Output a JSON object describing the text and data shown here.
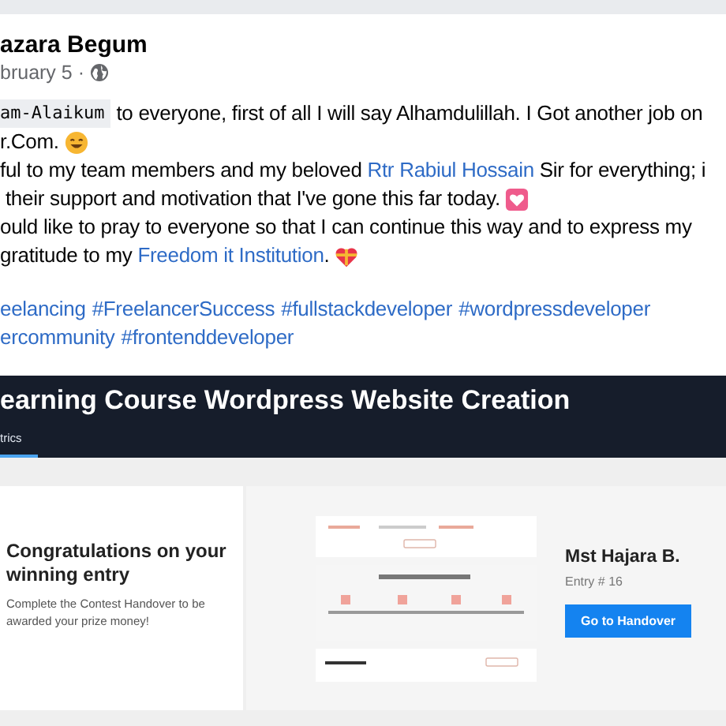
{
  "post": {
    "author": "azara Begum",
    "date": "bruary 5 ·",
    "body": [
      [
        {
          "kind": "code",
          "text": "am-Alaikum"
        },
        {
          "kind": "text",
          "text": " to everyone, first of all I will say Alhamdulillah. I Got another job on"
        }
      ],
      [
        {
          "kind": "text",
          "text": "r.Com. "
        },
        {
          "kind": "smiley"
        }
      ],
      [
        {
          "kind": "text",
          "text": "ful to my team members and my beloved "
        },
        {
          "kind": "link",
          "text": "Rtr Rabiul Hossain"
        },
        {
          "kind": "text",
          "text": " Sir for everything; i"
        }
      ],
      [
        {
          "kind": "text",
          "text": " their support and motivation that I've gone this far today. "
        },
        {
          "kind": "heartbox"
        }
      ],
      [
        {
          "kind": "text",
          "text": "ould like to pray to everyone so that I can continue this way and to express my"
        }
      ],
      [
        {
          "kind": "text",
          "text": "gratitude to my "
        },
        {
          "kind": "link",
          "text": "Freedom it Institution"
        },
        {
          "kind": "text",
          "text": ". "
        },
        {
          "kind": "heartgift"
        }
      ]
    ],
    "hashtags": [
      [
        "eelancing",
        "#FreelancerSuccess",
        "#fullstackdeveloper",
        "#wordpressdeveloper"
      ],
      [
        "ercommunity",
        "#frontenddeveloper"
      ]
    ]
  },
  "contest": {
    "title": "earning Course Wordpress Website Creation",
    "tabs": [
      {
        "label": "trics",
        "selected": true
      }
    ],
    "card": {
      "heading": "Congratulations on your winning entry",
      "text": "Complete the Contest Handover to be awarded your prize money!"
    },
    "entry": {
      "name": "Mst Hajara B.",
      "number": "Entry # 16",
      "button": "Go to Handover"
    }
  }
}
